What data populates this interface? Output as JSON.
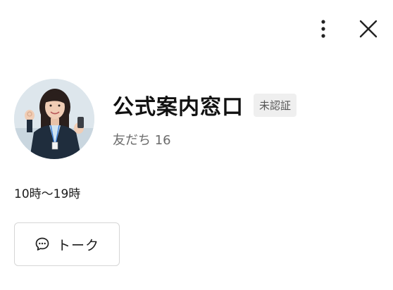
{
  "header": {
    "more_icon": "vertical-ellipsis-icon",
    "close_icon": "close-icon"
  },
  "profile": {
    "name": "公式案内窓口",
    "badge": "未認証",
    "friends_label": "友だち 16"
  },
  "business_hours": "10時〜19時",
  "actions": {
    "talk_label": "トーク",
    "talk_icon": "chat-bubble-icon"
  }
}
